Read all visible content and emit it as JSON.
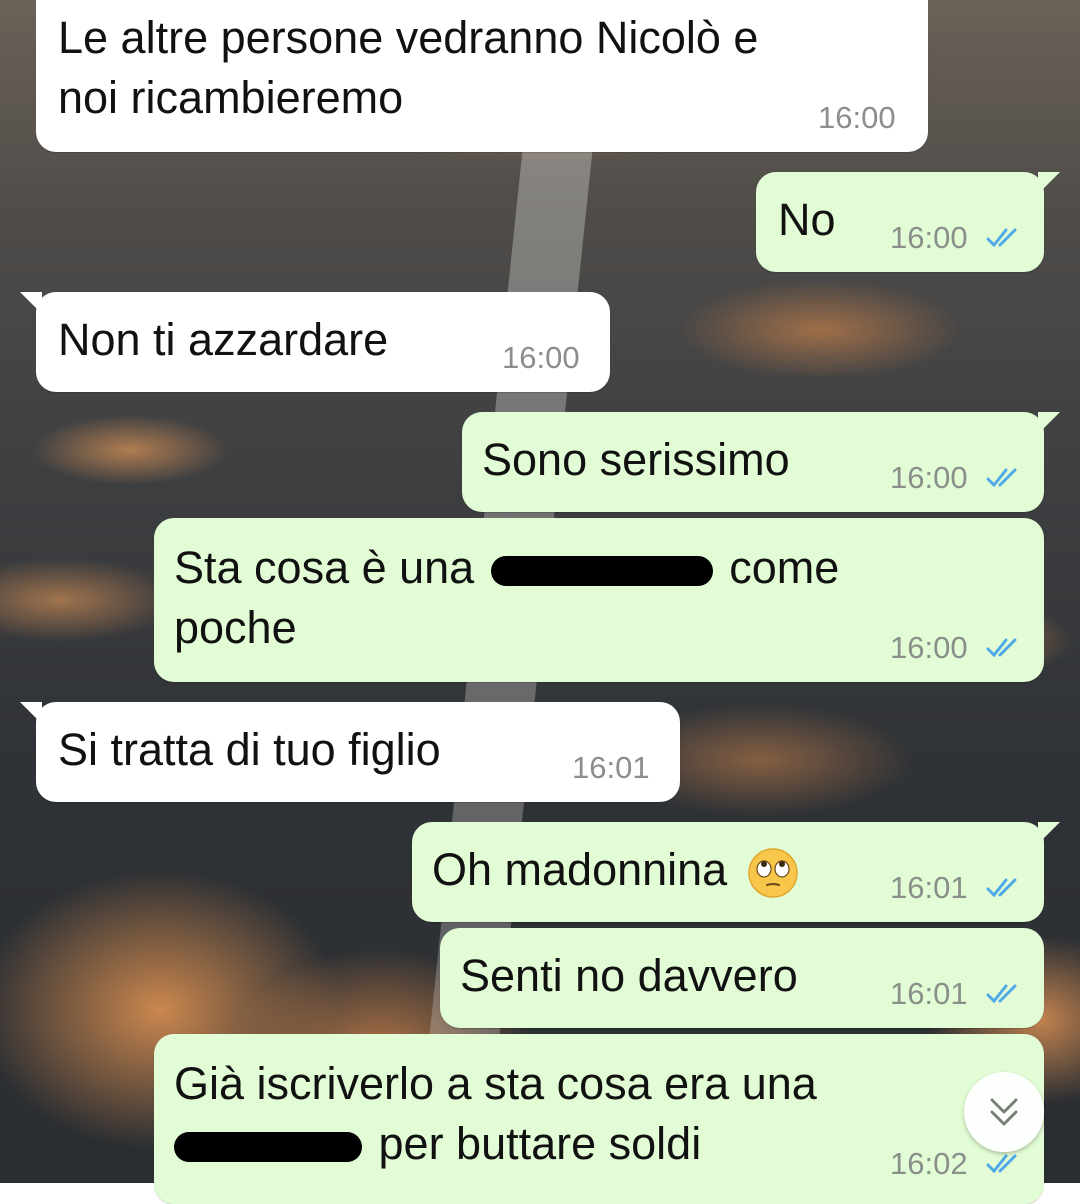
{
  "messages": [
    {
      "id": 1,
      "direction": "incoming",
      "lines": [
        "Le altre persone vedranno Nicolò e",
        "noi ricambieremo"
      ],
      "time": "16:00"
    },
    {
      "id": 2,
      "direction": "outgoing",
      "text": "No",
      "time": "16:00",
      "status": "read"
    },
    {
      "id": 3,
      "direction": "incoming",
      "text": "Non ti azzardare",
      "time": "16:00"
    },
    {
      "id": 4,
      "direction": "outgoing",
      "text": "Sono serissimo",
      "time": "16:00",
      "status": "read"
    },
    {
      "id": 5,
      "direction": "outgoing",
      "line1_before": "Sta cosa è una",
      "line1_after": "come",
      "line2": "poche",
      "time": "16:00",
      "status": "read",
      "redacted": true
    },
    {
      "id": 6,
      "direction": "incoming",
      "text": "Si tratta di tuo figlio",
      "time": "16:01"
    },
    {
      "id": 7,
      "direction": "outgoing",
      "text": "Oh madonnina",
      "emoji": "face-with-rolling-eyes",
      "time": "16:01",
      "status": "read"
    },
    {
      "id": 8,
      "direction": "outgoing",
      "text": "Senti no davvero",
      "time": "16:01",
      "status": "read"
    },
    {
      "id": 9,
      "direction": "outgoing",
      "line1": "Già iscriverlo a sta cosa era una",
      "line2_after": "per buttare soldi",
      "time": "16:02",
      "status": "read",
      "redacted": true
    }
  ],
  "colors": {
    "incoming_bubble": "#ffffff",
    "outgoing_bubble": "#e2fdd5",
    "read_ticks": "#4fa9e8",
    "timestamp": "#8a8f8a"
  },
  "scroll_button": {
    "icon": "double-chevron-down-icon"
  }
}
